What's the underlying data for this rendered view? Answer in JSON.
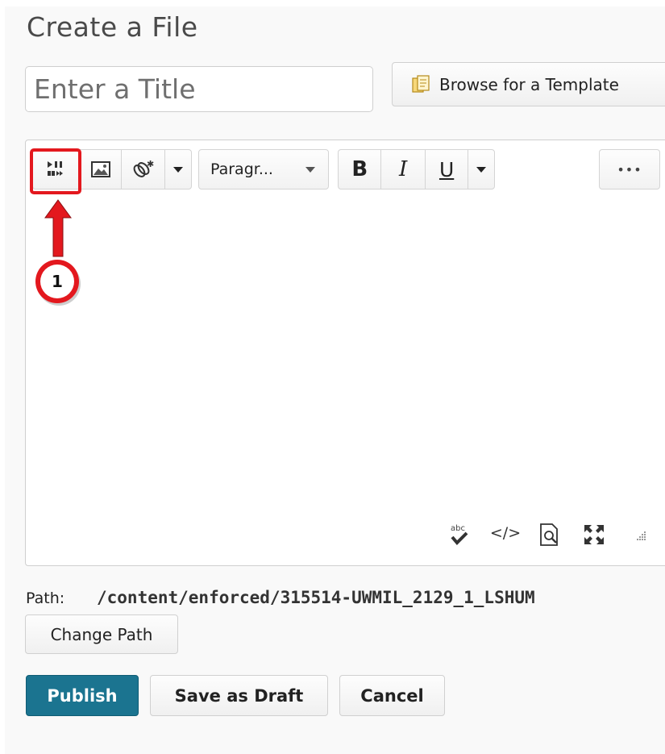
{
  "page": {
    "title": "Create a File",
    "title_input": {
      "placeholder": "Enter a Title",
      "value": ""
    },
    "browse_button": "Browse for a Template"
  },
  "editor": {
    "toolbar": {
      "insert_stuff_icon": "insert-stuff-icon",
      "insert_image_icon": "insert-image-icon",
      "insert_link_icon": "insert-quicklink-icon",
      "format_select": "Paragr...",
      "bold_label": "B",
      "italic_label": "I",
      "underline_label": "U",
      "more_label": "•••"
    },
    "footer_icons": [
      "spellcheck-icon",
      "source-code-icon",
      "preview-icon",
      "fullscreen-icon",
      "resize-handle-icon"
    ]
  },
  "annotation": {
    "marker_number": "1",
    "color": "#e3181e"
  },
  "path": {
    "label": "Path:",
    "value": "/content/enforced/315514-UWMIL_2129_1_LSHUM"
  },
  "buttons": {
    "change_path": "Change Path",
    "publish": "Publish",
    "save_draft": "Save as Draft",
    "cancel": "Cancel"
  },
  "colors": {
    "primary": "#1b7490",
    "annotation": "#e3181e"
  }
}
